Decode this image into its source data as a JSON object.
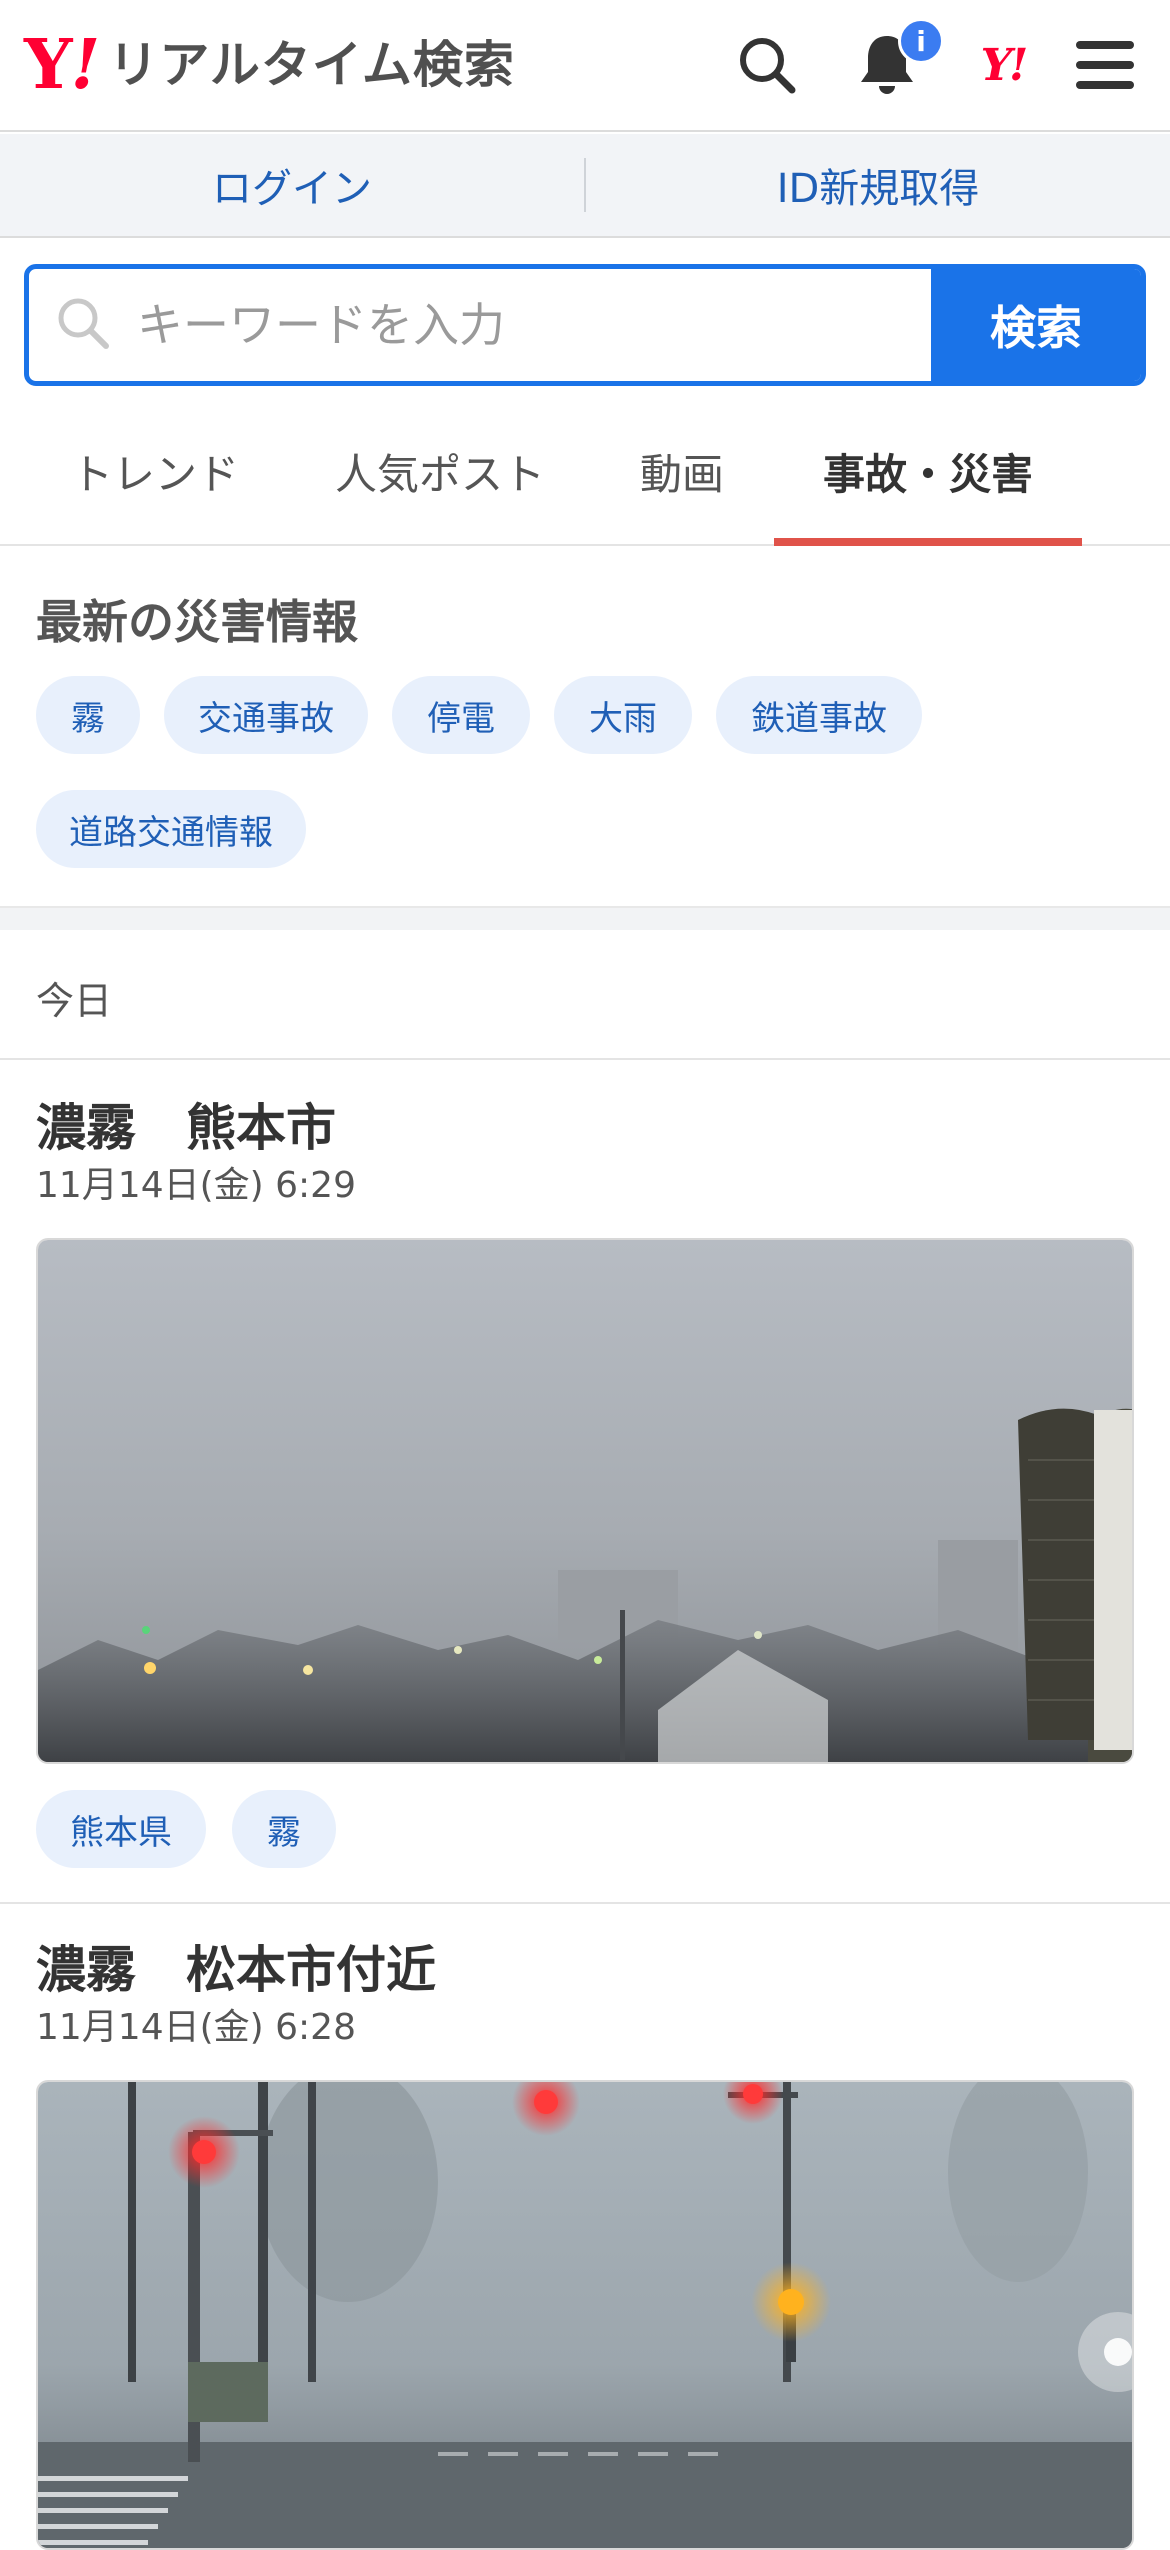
{
  "header": {
    "logo_mark": "Y",
    "logo_bang": "!",
    "logo_text": "リアルタイム検索",
    "notification_badge": "i",
    "yahoo_id_mark": "Y!"
  },
  "account": {
    "login": "ログイン",
    "signup": "ID新規取得"
  },
  "search": {
    "placeholder": "キーワードを入力",
    "button": "検索"
  },
  "tabs": [
    "トレンド",
    "人気ポスト",
    "動画",
    "事故・災害"
  ],
  "disaster_section": {
    "title": "最新の災害情報",
    "chips": [
      "霧",
      "交通事故",
      "停電",
      "大雨",
      "鉄道事故",
      "道路交通情報"
    ]
  },
  "day_label": "今日",
  "posts": [
    {
      "title": "濃霧　熊本市",
      "time": "11月14日(金) 6:29",
      "tags": [
        "熊本県",
        "霧"
      ]
    },
    {
      "title": "濃霧　松本市付近",
      "time": "11月14日(金) 6:28"
    }
  ],
  "colors": {
    "brand_red": "#ff0033",
    "accent_blue": "#1a73e8",
    "active_tab_underline": "#e0534a",
    "chip_bg": "#e8f0fc",
    "link_blue": "#1f5fb6"
  },
  "icons": [
    "search-icon",
    "bell-icon",
    "menu-icon"
  ]
}
